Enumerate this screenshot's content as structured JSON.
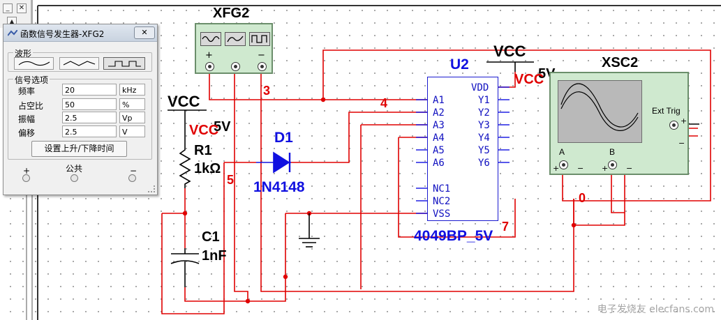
{
  "toolbar": {
    "minimize_symbol": "_",
    "close_symbol": "✕",
    "scroll_up_symbol": "▲",
    "scroll_down_symbol": "▼"
  },
  "function_generator_window": {
    "title": "函数信号发生器-XFG2",
    "close_symbol": "✕",
    "waveform_group_label": "波形",
    "waveforms": [
      "sine",
      "triangle",
      "square"
    ],
    "selected_waveform": "square",
    "signal_group_label": "信号选项",
    "rows": [
      {
        "label": "频率",
        "value": "20",
        "unit": "kHz"
      },
      {
        "label": "占空比",
        "value": "50",
        "unit": "%"
      },
      {
        "label": "振幅",
        "value": "2.5",
        "unit": "Vp"
      },
      {
        "label": "偏移",
        "value": "2.5",
        "unit": "V"
      }
    ],
    "rise_fall_button": "设置上升/下降时间",
    "terminal_plus": "+",
    "terminal_common": "公共",
    "terminal_minus": "−"
  },
  "schematic": {
    "xfg2_label": "XFG2",
    "xfg2_signs": {
      "plus": "+",
      "minus": "−"
    },
    "vcc_left": {
      "label": "VCC",
      "voltage": "5V",
      "net": "VCC"
    },
    "vcc_right": {
      "label": "VCC",
      "voltage": "5V",
      "net": "VCC"
    },
    "r1": {
      "ref": "R1",
      "value": "1kΩ"
    },
    "c1": {
      "ref": "C1",
      "value": "1nF"
    },
    "d1": {
      "ref": "D1",
      "part": "1N4148"
    },
    "u2": {
      "ref": "U2",
      "part": "4049BP_5V",
      "left_pins": [
        "A1",
        "A2",
        "A3",
        "A4",
        "A5",
        "A6",
        "NC1",
        "NC2",
        "VSS"
      ],
      "right_pins": [
        "VDD",
        "Y1",
        "Y2",
        "Y3",
        "Y4",
        "Y5",
        "Y6"
      ]
    },
    "xsc2": {
      "label": "XSC2",
      "ext_trig": "Ext Trig",
      "channel_a": "A",
      "channel_b": "B",
      "plus": "+",
      "minus": "−"
    },
    "net_labels": [
      "3",
      "4",
      "5",
      "7",
      "0"
    ]
  },
  "colors": {
    "wire": "#e00000",
    "component": "#1010e0",
    "label": "#000000",
    "instrument": "#cfe9cf"
  },
  "watermark": "电子发烧友 elecfans.com"
}
